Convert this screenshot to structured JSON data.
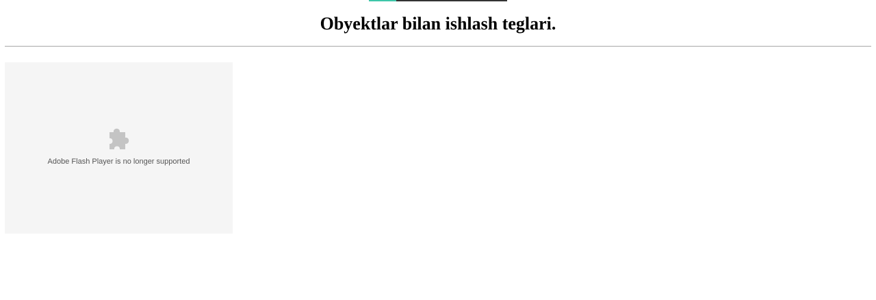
{
  "page": {
    "title": "Obyektlar bilan ishlash teglari."
  },
  "plugin": {
    "icon": "puzzle-piece-icon",
    "message": "Adobe Flash Player is no longer supported"
  },
  "colors": {
    "background": "#ffffff",
    "divider": "#a8a8a8",
    "plugin_background": "#f5f5f5",
    "plugin_icon": "#c4c4c4",
    "accent": "#3ec6a8"
  }
}
